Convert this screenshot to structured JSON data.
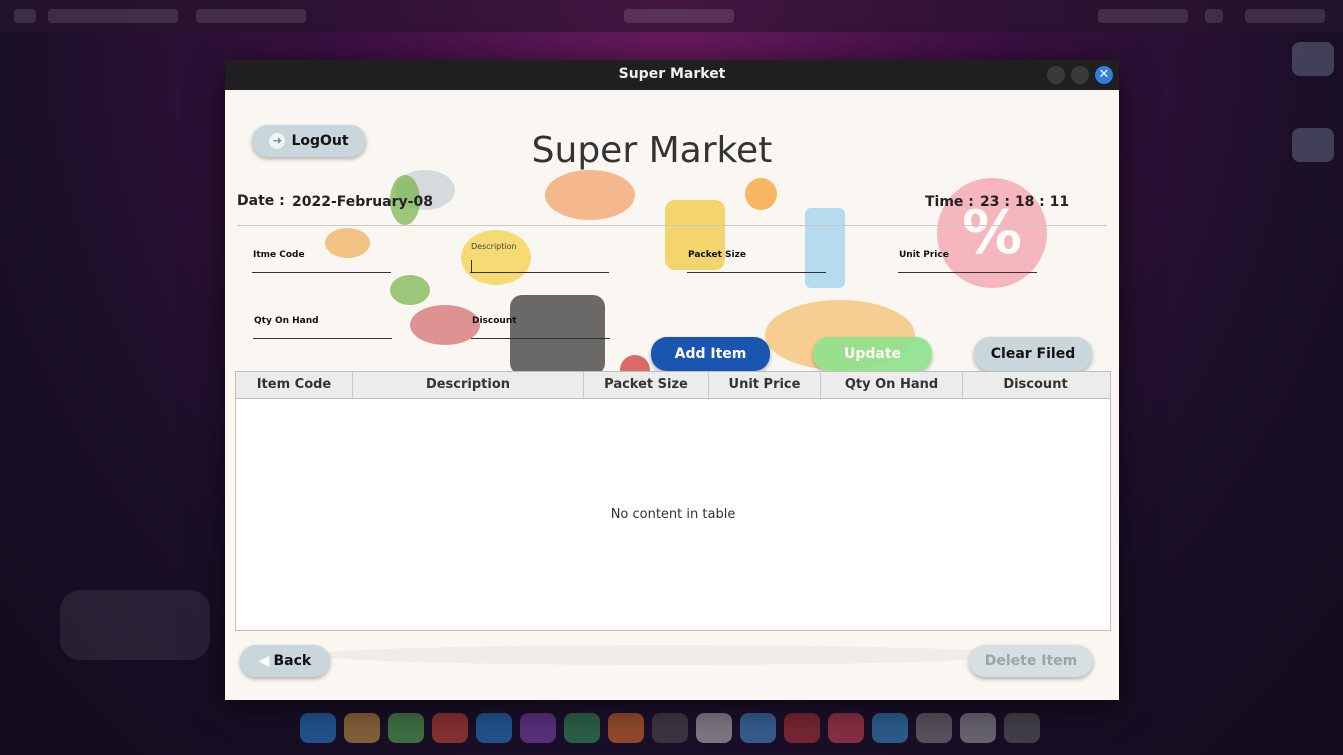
{
  "window": {
    "title": "Super Market"
  },
  "app": {
    "title": "Super Market"
  },
  "header": {
    "logout_label": "LogOut",
    "date_label": "Date  :",
    "date_value": "2022-February-08",
    "time_label": "Time  :",
    "time_value": "23 : 18 : 11"
  },
  "badge": {
    "symbol": "%"
  },
  "form": {
    "item_code_label": "Itme Code",
    "description_label": "Description",
    "packet_size_label": "Packet Size",
    "unit_price_label": "Unit Price",
    "qty_on_hand_label": "Qty On Hand",
    "discount_label": "Discount"
  },
  "buttons": {
    "add": "Add Item",
    "update": "Update",
    "clear": "Clear Filed",
    "back": "Back",
    "delete": "Delete Item"
  },
  "table": {
    "columns": [
      "Item Code",
      "Description",
      "Packet Size",
      "Unit Price",
      "Qty On Hand",
      "Discount"
    ],
    "empty_message": "No content in table"
  },
  "colors": {
    "primary_button": "#1a56b0",
    "update_button": "#8ee38e",
    "neutral_button": "#c9d7dc",
    "titlebar": "#1f1f21",
    "close_button": "#2f7ee0"
  }
}
